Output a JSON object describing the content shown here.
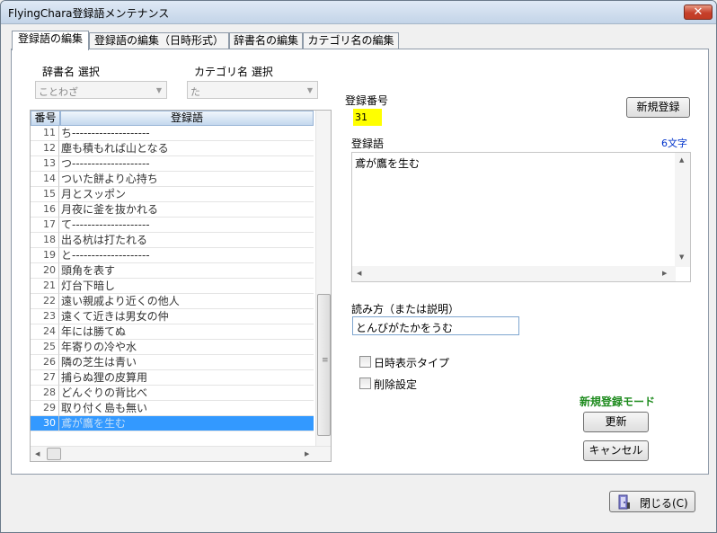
{
  "window": {
    "title": "FlyingChara登録語メンテナンス",
    "close_label": "✕"
  },
  "tabs": [
    {
      "label": "登録語の編集"
    },
    {
      "label": "登録語の編集（日時形式）"
    },
    {
      "label": "辞書名の編集"
    },
    {
      "label": "カテゴリ名の編集"
    }
  ],
  "dictionary": {
    "label": "辞書名 選択",
    "value": "ことわざ"
  },
  "category": {
    "label": "カテゴリ名 選択",
    "value": "た"
  },
  "grid": {
    "col_num": "番号",
    "col_word": "登録語",
    "rows": [
      {
        "num": "11",
        "word": "ち--------------------"
      },
      {
        "num": "12",
        "word": "塵も積もれば山となる"
      },
      {
        "num": "13",
        "word": "つ--------------------"
      },
      {
        "num": "14",
        "word": "ついた餅より心持ち"
      },
      {
        "num": "15",
        "word": "月とスッポン"
      },
      {
        "num": "16",
        "word": "月夜に釜を抜かれる"
      },
      {
        "num": "17",
        "word": "て--------------------"
      },
      {
        "num": "18",
        "word": "出る杭は打たれる"
      },
      {
        "num": "19",
        "word": "と--------------------"
      },
      {
        "num": "20",
        "word": "頭角を表す"
      },
      {
        "num": "21",
        "word": "灯台下暗し"
      },
      {
        "num": "22",
        "word": "遠い親戚より近くの他人"
      },
      {
        "num": "23",
        "word": "遠くて近きは男女の仲"
      },
      {
        "num": "24",
        "word": "年には勝てぬ"
      },
      {
        "num": "25",
        "word": "年寄りの冷や水"
      },
      {
        "num": "26",
        "word": "隣の芝生は青い"
      },
      {
        "num": "27",
        "word": "捕らぬ狸の皮算用"
      },
      {
        "num": "28",
        "word": "どんぐりの背比べ"
      },
      {
        "num": "29",
        "word": "取り付く島も無い"
      },
      {
        "num": "30",
        "word": "鳶が鷹を生む",
        "selected": true
      }
    ]
  },
  "reg_number": {
    "label": "登録番号",
    "value": "31"
  },
  "new_button": "新規登録",
  "word_field": {
    "label": "登録語",
    "count": "6文字",
    "value": "鳶が鷹を生む"
  },
  "reading": {
    "label": "読み方（または説明）",
    "value": "とんびがたかをうむ"
  },
  "checkbox_datetime": "日時表示タイプ",
  "checkbox_delete": "削除設定",
  "mode_label": "新規登録モード",
  "update_button": "更新",
  "cancel_button": "キャンセル",
  "close_button": "閉じる(C)",
  "colors": {
    "selection": "#3399ff",
    "id_highlight": "#ffff00",
    "mode_text": "#1e8b1e",
    "count_text": "#0033cc"
  }
}
